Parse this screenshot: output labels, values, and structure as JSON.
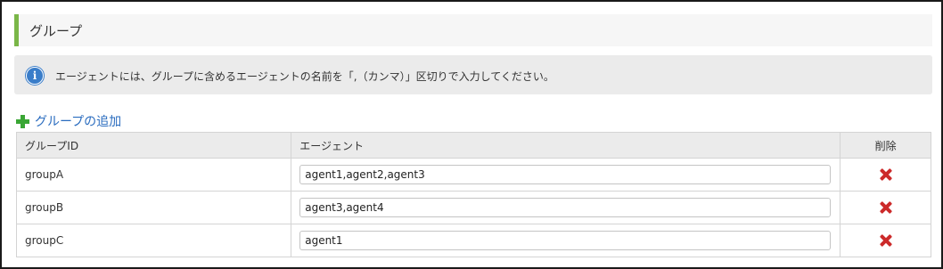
{
  "section": {
    "title": "グループ"
  },
  "info": {
    "icon": "info-icon",
    "text": "エージェントには、グループに含めるエージェントの名前を「,（カンマ）」区切りで入力してください。"
  },
  "add_group": {
    "icon": "plus-icon",
    "label": "グループの追加",
    "color": "#3aa635"
  },
  "table": {
    "headers": {
      "group_id": "グループID",
      "agent": "エージェント",
      "delete": "削除"
    },
    "rows": [
      {
        "group_id": "groupA",
        "agents": "agent1,agent2,agent3",
        "delete_icon": "delete-icon"
      },
      {
        "group_id": "groupB",
        "agents": "agent3,agent4",
        "delete_icon": "delete-icon"
      },
      {
        "group_id": "groupC",
        "agents": "agent1",
        "delete_icon": "delete-icon"
      }
    ]
  },
  "colors": {
    "accent_bar": "#7ab648",
    "link": "#2a6cbf",
    "delete": "#cc2a2a",
    "info_icon": "#3a7dc9"
  }
}
